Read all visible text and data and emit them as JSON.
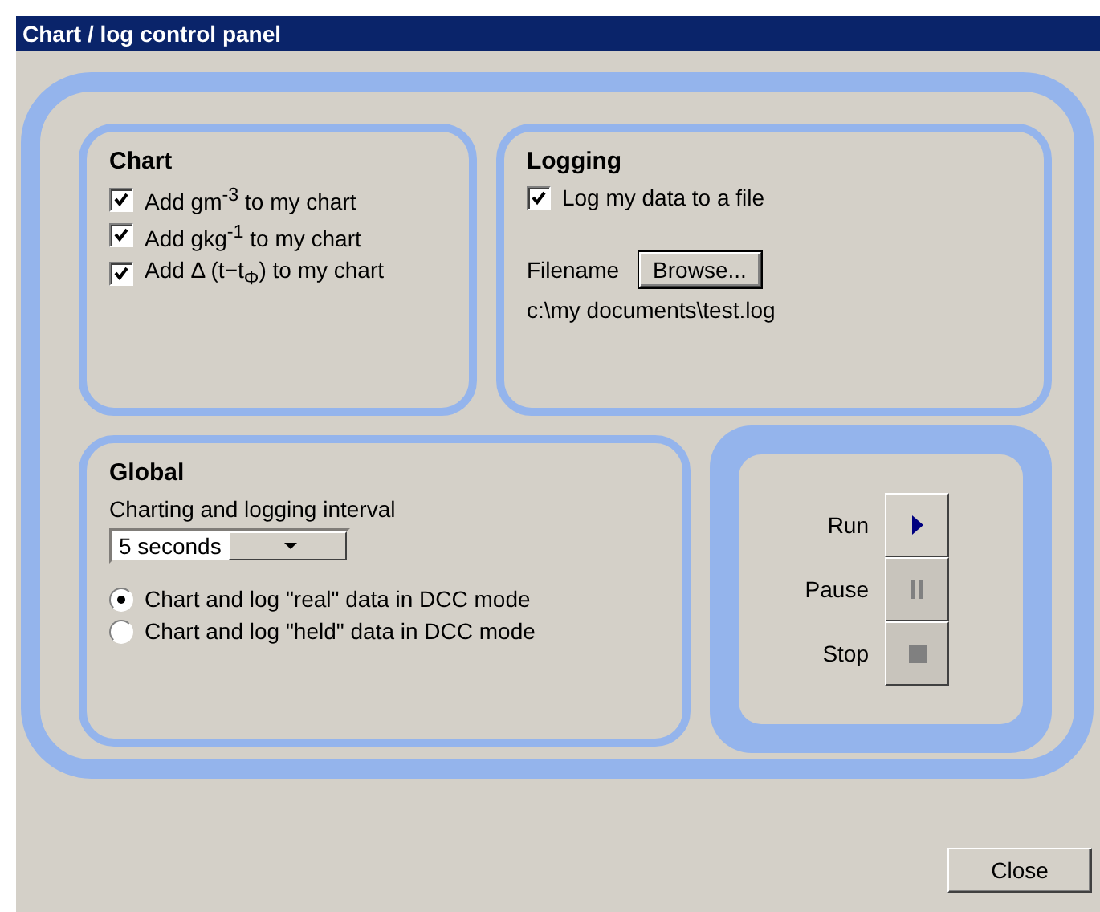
{
  "window": {
    "title": "Chart / log control panel"
  },
  "chart": {
    "title": "Chart",
    "options": [
      {
        "label": "Add gm$^{-3}$ to my chart",
        "checked": true
      },
      {
        "label": "Add gkg$^{-1}$ to my chart",
        "checked": true
      },
      {
        "label": "Add Δ (t−t$_{Φ}$) to my chart",
        "checked": true
      }
    ]
  },
  "logging": {
    "title": "Logging",
    "option": {
      "label": "Log my data to a file",
      "checked": true
    },
    "filename_label": "Filename",
    "browse_button": "Browse...",
    "path": "c:\\my documents\\test.log"
  },
  "global": {
    "title": "Global",
    "interval_label": "Charting and logging interval",
    "interval": "5 seconds",
    "modes": [
      {
        "label": "Chart and log \"real\" data in DCC mode",
        "selected": true
      },
      {
        "label": "Chart and log \"held\" data in DCC mode",
        "selected": false
      }
    ]
  },
  "controls": [
    {
      "label": "Run",
      "kind": "play",
      "disabled": false
    },
    {
      "label": "Pause",
      "kind": "pause",
      "disabled": true
    },
    {
      "label": "Stop",
      "kind": "stop",
      "disabled": true
    }
  ],
  "close_button": "Close"
}
